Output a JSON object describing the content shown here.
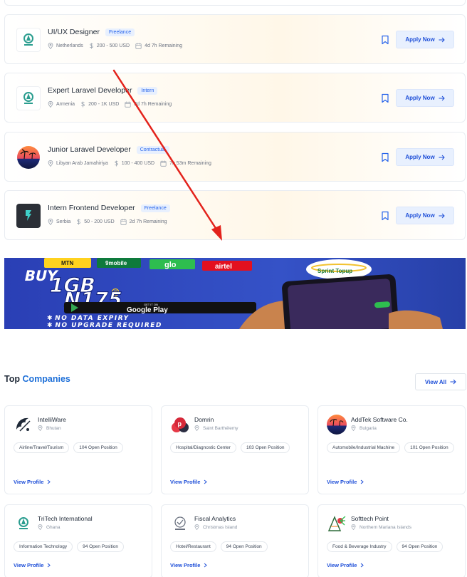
{
  "jobs": [
    {
      "title": "UI/UX Designer",
      "type": "Freelance",
      "location": "Netherlands",
      "salary": "200 - 500 USD",
      "remaining": "4d 7h Remaining",
      "apply_label": "Apply Now"
    },
    {
      "title": "Expert Laravel Developer",
      "type": "Intern",
      "location": "Armenia",
      "salary": "200 - 1K USD",
      "remaining": "3d 7h Remaining",
      "apply_label": "Apply Now"
    },
    {
      "title": "Junior Laravel Developer",
      "type": "Contractual",
      "location": "Libyan Arab Jamahiriya",
      "salary": "100 - 400 USD",
      "remaining": "7h 53m Remaining",
      "apply_label": "Apply Now"
    },
    {
      "title": "Intern Frontend Developer",
      "type": "Freelance",
      "location": "Serbia",
      "salary": "50 - 200 USD",
      "remaining": "2d 7h Remaining",
      "apply_label": "Apply Now"
    }
  ],
  "banner": {
    "line1": "BUY",
    "line2": "1GB",
    "at": "@",
    "price": "N175",
    "store_small": "GET IT ON",
    "store": "Google Play",
    "bullet1": "NO DATA EXPIRY",
    "bullet2": "NO UPGRADE REQUIRED",
    "networks": [
      "MTN",
      "9mobile",
      "glo",
      "airtel"
    ],
    "brand": "Sprint Topup"
  },
  "top_companies": {
    "title_plain": "Top",
    "title_accent": "Companies",
    "view_all_label": "View All"
  },
  "companies": [
    {
      "name": "IntelliWare",
      "location": "Bhutan",
      "tags": [
        "Airline/Travel/Tourism",
        "104 Open Position"
      ],
      "view_label": "View Profile"
    },
    {
      "name": "Domrin",
      "location": "Saint Barthélemy",
      "tags": [
        "Hospital/Diagnostic Center",
        "103 Open Position"
      ],
      "view_label": "View Profile"
    },
    {
      "name": "AddTek Software Co.",
      "location": "Bulgaria",
      "tags": [
        "Automobile/Industrial Machine",
        "101 Open Position"
      ],
      "view_label": "View Profile"
    },
    {
      "name": "TriTech International",
      "location": "Ghana",
      "tags": [
        "Information Technology",
        "94 Open Position"
      ],
      "view_label": "View Profile"
    },
    {
      "name": "Fiscal Analytics",
      "location": "Christmas Island",
      "tags": [
        "Hotel/Restaurant",
        "94 Open Position"
      ],
      "view_label": "View Profile"
    },
    {
      "name": "Softtech Point",
      "location": "Northern Mariana Islands",
      "tags": [
        "Food & Beverage Industry",
        "94 Open Position"
      ],
      "view_label": "View Profile"
    }
  ],
  "colors": {
    "accent": "#1d4ed8",
    "badge_bg": "#e8f0fe",
    "annotation": "#e3221b"
  }
}
